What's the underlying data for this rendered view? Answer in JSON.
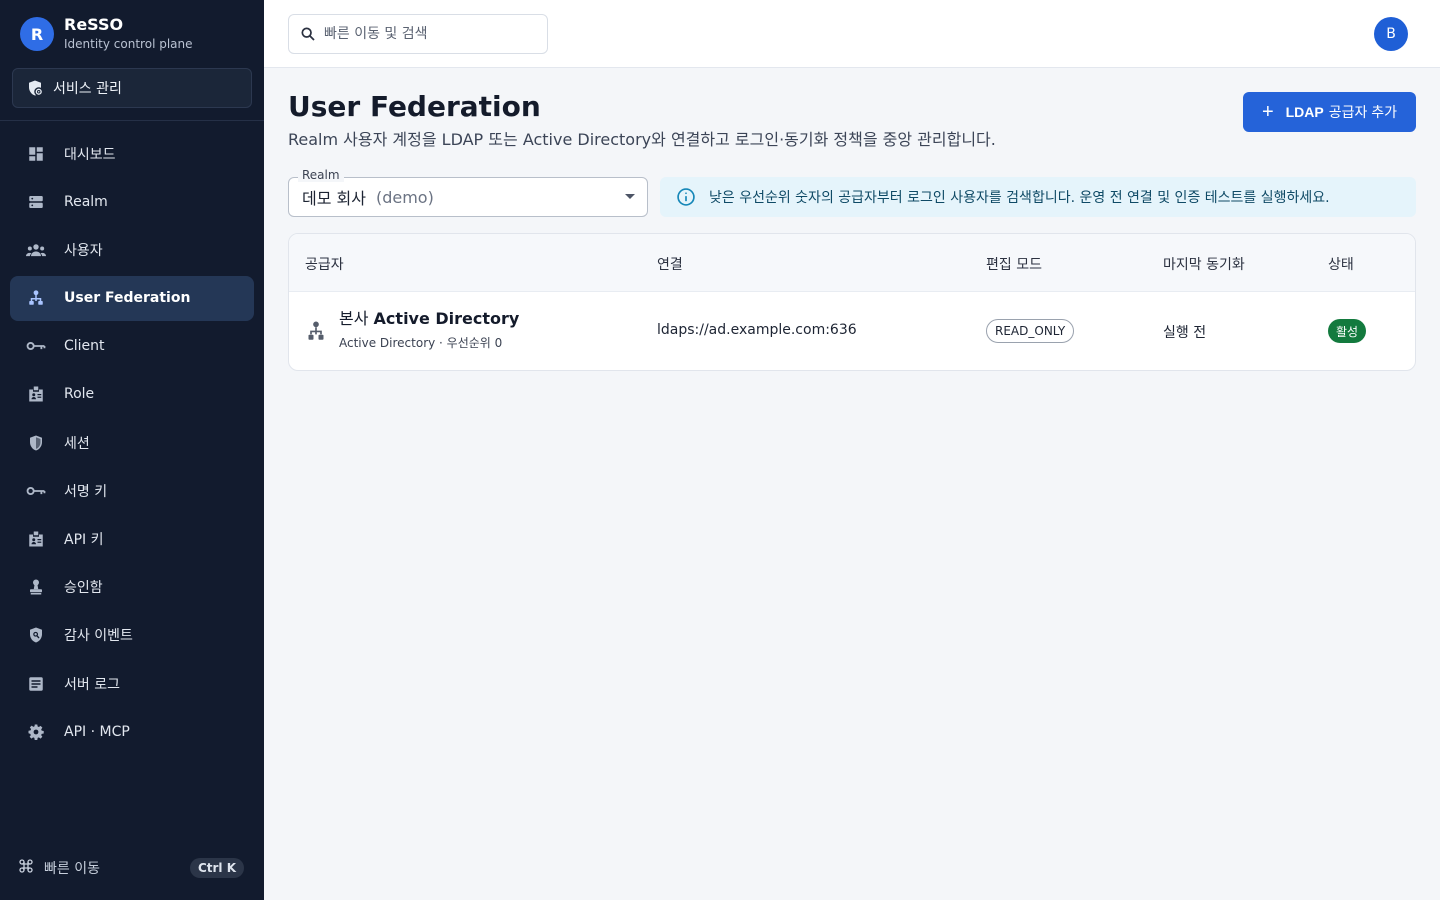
{
  "app": {
    "logo_letter": "R",
    "name": "ReSSO",
    "subtitle": "Identity control plane"
  },
  "sidebar": {
    "service_button": "서비스 관리",
    "items": [
      {
        "label": "대시보드",
        "icon": "dashboard-icon",
        "active": false
      },
      {
        "label": "Realm",
        "icon": "realm-icon",
        "active": false
      },
      {
        "label": "사용자",
        "icon": "users-icon",
        "active": false
      },
      {
        "label": "User Federation",
        "icon": "federation-icon",
        "active": true
      },
      {
        "label": "Client",
        "icon": "key-icon",
        "active": false
      },
      {
        "label": "Role",
        "icon": "badge-icon",
        "active": false
      },
      {
        "label": "세션",
        "icon": "shield-icon",
        "active": false
      },
      {
        "label": "서명 키",
        "icon": "key-icon",
        "active": false
      },
      {
        "label": "API 키",
        "icon": "badge-icon",
        "active": false
      },
      {
        "label": "승인함",
        "icon": "approval-icon",
        "active": false
      },
      {
        "label": "감사 이벤트",
        "icon": "audit-icon",
        "active": false
      },
      {
        "label": "서버 로그",
        "icon": "log-icon",
        "active": false
      },
      {
        "label": "API · MCP",
        "icon": "gear-icon",
        "active": false
      }
    ],
    "quick_nav": {
      "label": "빠른 이동",
      "shortcut": "Ctrl K"
    }
  },
  "topbar": {
    "search_placeholder": "빠른 이동 및 검색",
    "avatar_letter": "B"
  },
  "main": {
    "title": "User Federation",
    "description": "Realm 사용자 계정을 LDAP 또는 Active Directory와 연결하고 로그인·동기화 정책을 중앙 관리합니다.",
    "add_button": {
      "strong": "LDAP",
      "rest": "공급자 추가"
    },
    "realm": {
      "label": "Realm",
      "value": "데모 회사",
      "slug": "(demo)"
    },
    "info": "낮은 우선순위 숫자의 공급자부터 로그인 사용자를 검색합니다. 운영 전 연결 및 인증 테스트를 실행하세요.",
    "table": {
      "headers": {
        "provider": "공급자",
        "connection": "연결",
        "edit_mode": "편집 모드",
        "last_sync": "마지막 동기화",
        "status": "상태"
      },
      "rows": [
        {
          "name_prefix": "본사",
          "name_strong": "Active Directory",
          "sub": "Active Directory · 우선순위 0",
          "connection": "ldaps://ad.example.com:636",
          "edit_mode": "READ_ONLY",
          "last_sync": "실행 전",
          "status": "활성"
        }
      ]
    }
  },
  "colors": {
    "sidebar_bg": "#121b2e",
    "accent": "#2563d9",
    "active_status": "#137a3e",
    "info_bg": "#e5f4fb"
  }
}
